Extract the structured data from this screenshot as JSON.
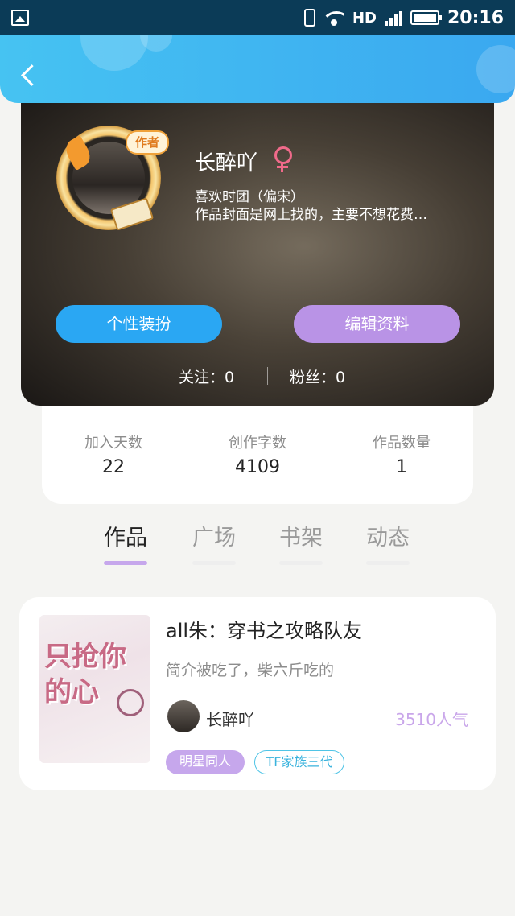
{
  "status_bar": {
    "network": "HD",
    "network_gen": "4G",
    "time": "20:16"
  },
  "header": {
    "back_icon": "chevron-left-icon"
  },
  "profile": {
    "username": "长醉吖",
    "gender_icon": "female-symbol-icon",
    "bio_line1": "喜欢时团（偏宋）",
    "bio_line2": "作品封面是网上找的，主要不想花费…",
    "author_badge": "作者",
    "dress_button": "个性装扮",
    "edit_button": "编辑资料",
    "follows": "关注：0",
    "fans": "粉丝：0"
  },
  "stats": [
    {
      "label": "加入天数",
      "value": "22"
    },
    {
      "label": "创作字数",
      "value": "4109"
    },
    {
      "label": "作品数量",
      "value": "1"
    }
  ],
  "tabs": [
    {
      "label": "作品",
      "active": true
    },
    {
      "label": "广场",
      "active": false
    },
    {
      "label": "书架",
      "active": false
    },
    {
      "label": "动态",
      "active": false
    }
  ],
  "works": [
    {
      "title": "all朱：穿书之攻略队友",
      "description": "简介被吃了，柴六斤吃的",
      "author": "长醉吖",
      "popularity": "3510人气",
      "cover_text": "只抢你的心",
      "tags": [
        "明星同人",
        "TF家族三代"
      ]
    }
  ],
  "colors": {
    "header_gradient_start": "#46c3f2",
    "header_gradient_end": "#3aa8f0",
    "dress_button": "#2aa7f3",
    "edit_button": "#b993e6",
    "tab_underline": "#c6a7ec",
    "popularity": "#c9a6ea",
    "gender": "#f06a8a"
  }
}
